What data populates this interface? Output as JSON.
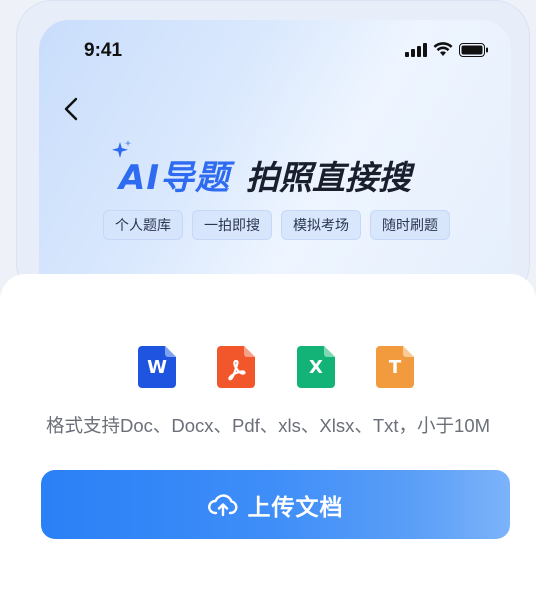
{
  "status_bar": {
    "time": "9:41"
  },
  "header": {
    "highlight": "AI导题",
    "title_rest": "拍照直接搜",
    "tags": [
      "个人题库",
      "一拍即搜",
      "模拟考场",
      "随时刷题"
    ]
  },
  "file_types": [
    {
      "name": "word",
      "letter": "W",
      "color": "#1e54e0"
    },
    {
      "name": "pdf",
      "letter": "",
      "color": "#f2562b"
    },
    {
      "name": "excel",
      "letter": "X",
      "color": "#13b377"
    },
    {
      "name": "txt",
      "letter": "T",
      "color": "#f29b3e"
    }
  ],
  "formats_text": "格式支持Doc、Docx、Pdf、xls、Xlsx、Txt，小于10M",
  "upload_button": {
    "label": "上传文档"
  }
}
